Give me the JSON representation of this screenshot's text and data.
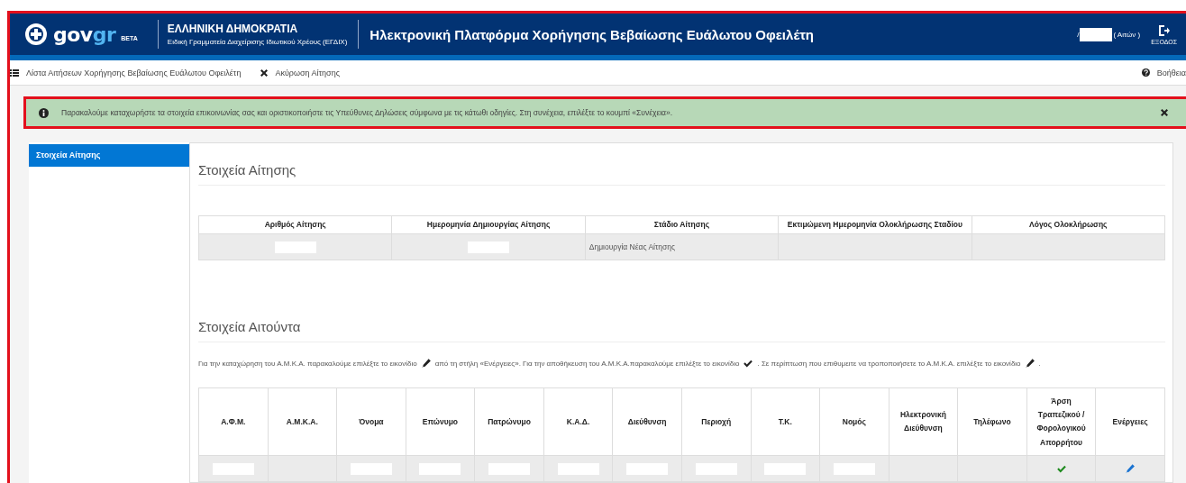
{
  "page": {
    "highlighted": true
  },
  "header": {
    "logo": {
      "parts": [
        "gov",
        "gr"
      ],
      "badge": "BETA"
    },
    "org": {
      "name": "ΕΛΛΗΝΙΚΗ ΔΗΜΟΚΡΑΤΙΑ",
      "unit": "Ειδική Γραμματεία Διαχείρισης Ιδιωτικού Χρέους (ΕΓΔΙΧ)"
    },
    "title": "Ηλεκτρονική Πλατφόρμα Χορήγησης Βεβαίωσης Ευάλωτου Οφειλέτη",
    "user": {
      "separator": "/",
      "redacted": true,
      "role": "( Αιτών )"
    },
    "logout": "ΕΞΟΔΟΣ"
  },
  "nav": {
    "links": [
      {
        "kind": "list",
        "label": "Λίστα Αιτήσεων Χορήγησης Βεβαίωσης Ευάλωτου Οφειλέτη"
      },
      {
        "kind": "cancel",
        "label": "Ακύρωση Αίτησης"
      }
    ],
    "help": "Βοήθεια"
  },
  "alert": {
    "highlighted": true,
    "message": "Παρακαλούμε καταχωρήστε τα στοιχεία επικοινωνίας σας και οριστικοποιήστε τις Υπεύθυνες Δηλώσεις σύμφωνα με τις κάτωθι οδηγίες. Στη συνέχεια, επιλέξτε το κουμπί «Συνέχεια»."
  },
  "sidebar": {
    "items": [
      {
        "label": "Στοιχεία Αίτησης",
        "selected": true
      }
    ]
  },
  "sections": [
    {
      "title": "Στοιχεία Αίτησης",
      "table": {
        "columns": [
          "Αριθμός Αίτησης",
          "Ημερομηνία Δημιουργίας Αίτησης",
          "Στάδιο Αίτησης",
          "Εκτιμώμενη Ημερομηνία Ολοκλήρωσης Σταδίου",
          "Λόγος Ολοκλήρωσης"
        ],
        "rows": [
          [
            {
              "kind": "redacted"
            },
            {
              "kind": "redacted"
            },
            {
              "kind": "text",
              "text": "Δημιουργία Νέας Αίτησης"
            },
            {
              "kind": "empty"
            },
            {
              "kind": "empty"
            }
          ]
        ]
      }
    },
    {
      "title": "Στοιχεία Αιτούντα",
      "instructions": [
        {
          "kind": "text",
          "text": "Για την καταχώρηση του Α.Μ.Κ.Α. παρακαλούμε επιλέξτε το εικονίδιο"
        },
        {
          "kind": "edit"
        },
        {
          "kind": "text",
          "text": "από τη στήλη «Ενέργειες». Για την αποθήκευση του Α.Μ.Κ.Α.παρακαλούμε επιλέξτε το εικονίδιο"
        },
        {
          "kind": "confirm"
        },
        {
          "kind": "text",
          "text": ". Σε περίπτωση που επιθυμειτε να τροποποιήσετε το Α.Μ.Κ.Α. επιλέξτε το εικονίδιο"
        },
        {
          "kind": "edit"
        },
        {
          "kind": "text",
          "text": "."
        }
      ],
      "table": {
        "columns": [
          "Α.Φ.Μ.",
          "Α.Μ.Κ.Α.",
          "Όνομα",
          "Επώνυμο",
          "Πατρώνυμο",
          "Κ.Α.Δ.",
          "Διεύθυνση",
          "Περιοχή",
          "Τ.Κ.",
          "Νομός",
          "Ηλεκτρονική Διεύθυνση",
          "Τηλέφωνο",
          "Άρση Τραπεζικού / Φορολογικού Απορρήτου",
          "Ενέργειες"
        ],
        "rows": [
          [
            {
              "kind": "redacted"
            },
            {
              "kind": "empty"
            },
            {
              "kind": "redacted"
            },
            {
              "kind": "redacted"
            },
            {
              "kind": "redacted"
            },
            {
              "kind": "redacted"
            },
            {
              "kind": "redacted"
            },
            {
              "kind": "redacted"
            },
            {
              "kind": "redacted"
            },
            {
              "kind": "redacted"
            },
            {
              "kind": "empty"
            },
            {
              "kind": "empty"
            },
            {
              "kind": "confirm"
            },
            {
              "kind": "edit"
            }
          ]
        ]
      }
    }
  ]
}
